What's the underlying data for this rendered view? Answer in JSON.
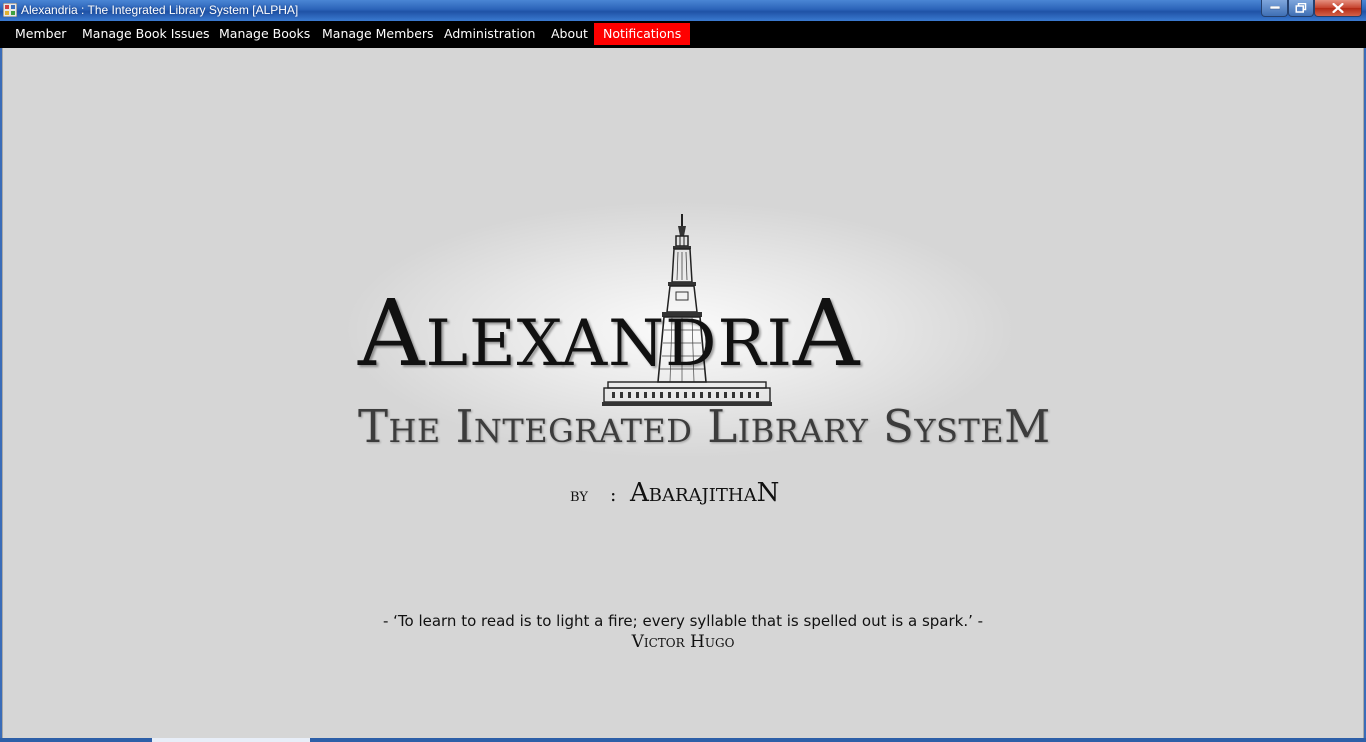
{
  "window": {
    "title": "Alexandria : The Integrated Library System [ALPHA]",
    "controls": {
      "minimize": "minimize-icon",
      "maximize": "restore-icon",
      "close": "close-icon"
    }
  },
  "menu": {
    "items": [
      {
        "label": "Member"
      },
      {
        "label": "Manage Book Issues"
      },
      {
        "label": "Manage Books"
      },
      {
        "label": "Manage Members"
      },
      {
        "label": "Administration"
      },
      {
        "label": "About"
      },
      {
        "label": "Notifications"
      }
    ],
    "highlight_color": "#ff0000"
  },
  "logo": {
    "name": "AlexandriA",
    "tagline": "The Integrated Library SysteM",
    "icon": "lighthouse-icon"
  },
  "byline": {
    "label": "by",
    "separator": ":",
    "author": "AbarajithaN"
  },
  "quote": {
    "text": "- ‘To learn to read is to light a fire; every syllable that is spelled out is a spark.’  -",
    "author": "Victor Hugo"
  },
  "colors": {
    "background": "#d6d6d6",
    "menubar": "#000000",
    "titlebar": "#2b63b8"
  }
}
